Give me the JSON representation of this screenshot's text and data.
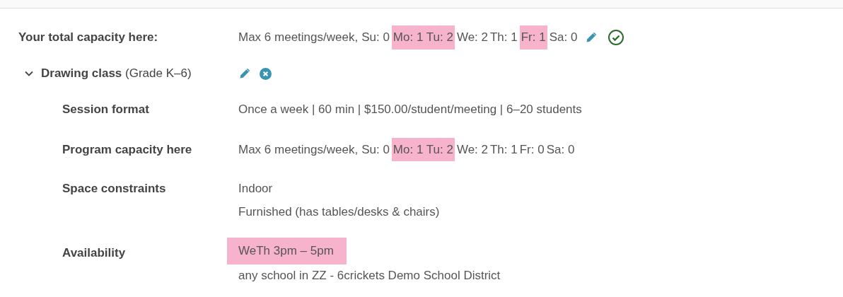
{
  "total_capacity": {
    "label": "Your total capacity here:",
    "summary": "Max 6 meetings/week,",
    "days": [
      {
        "text": "Su: 0",
        "highlighted": false
      },
      {
        "text": "Mo: 1",
        "highlighted": true
      },
      {
        "text": "Tu: 2",
        "highlighted": true
      },
      {
        "text": "We: 2",
        "highlighted": false
      },
      {
        "text": "Th: 1",
        "highlighted": false
      },
      {
        "text": "Fr: 1",
        "highlighted": true
      },
      {
        "text": "Sa: 0",
        "highlighted": false
      }
    ]
  },
  "program": {
    "name": "Drawing class",
    "grade": "(Grade K–6)",
    "expanded": true,
    "fields": [
      {
        "kind": "text",
        "label": "Session format",
        "lines": [
          "Once a week | 60 min | $150.00/student/meeting | 6–20 students"
        ]
      },
      {
        "kind": "capacity",
        "label": "Program capacity here",
        "summary": "Max 6 meetings/week,",
        "days": [
          {
            "text": "Su: 0",
            "highlighted": false
          },
          {
            "text": "Mo: 1",
            "highlighted": true
          },
          {
            "text": "Tu: 2",
            "highlighted": true
          },
          {
            "text": "We: 2",
            "highlighted": false
          },
          {
            "text": "Th: 1",
            "highlighted": false
          },
          {
            "text": "Fr: 0",
            "highlighted": false
          },
          {
            "text": "Sa: 0",
            "highlighted": false
          }
        ]
      },
      {
        "kind": "text",
        "label": "Space constraints",
        "lines": [
          "Indoor",
          "Furnished (has tables/desks & chairs)"
        ]
      },
      {
        "kind": "availability",
        "label": "Availability",
        "slot": "WeTh 3pm – 5pm",
        "highlighted": true,
        "lines": [
          "any school in ZZ - 6crickets Demo School District"
        ]
      }
    ]
  }
}
